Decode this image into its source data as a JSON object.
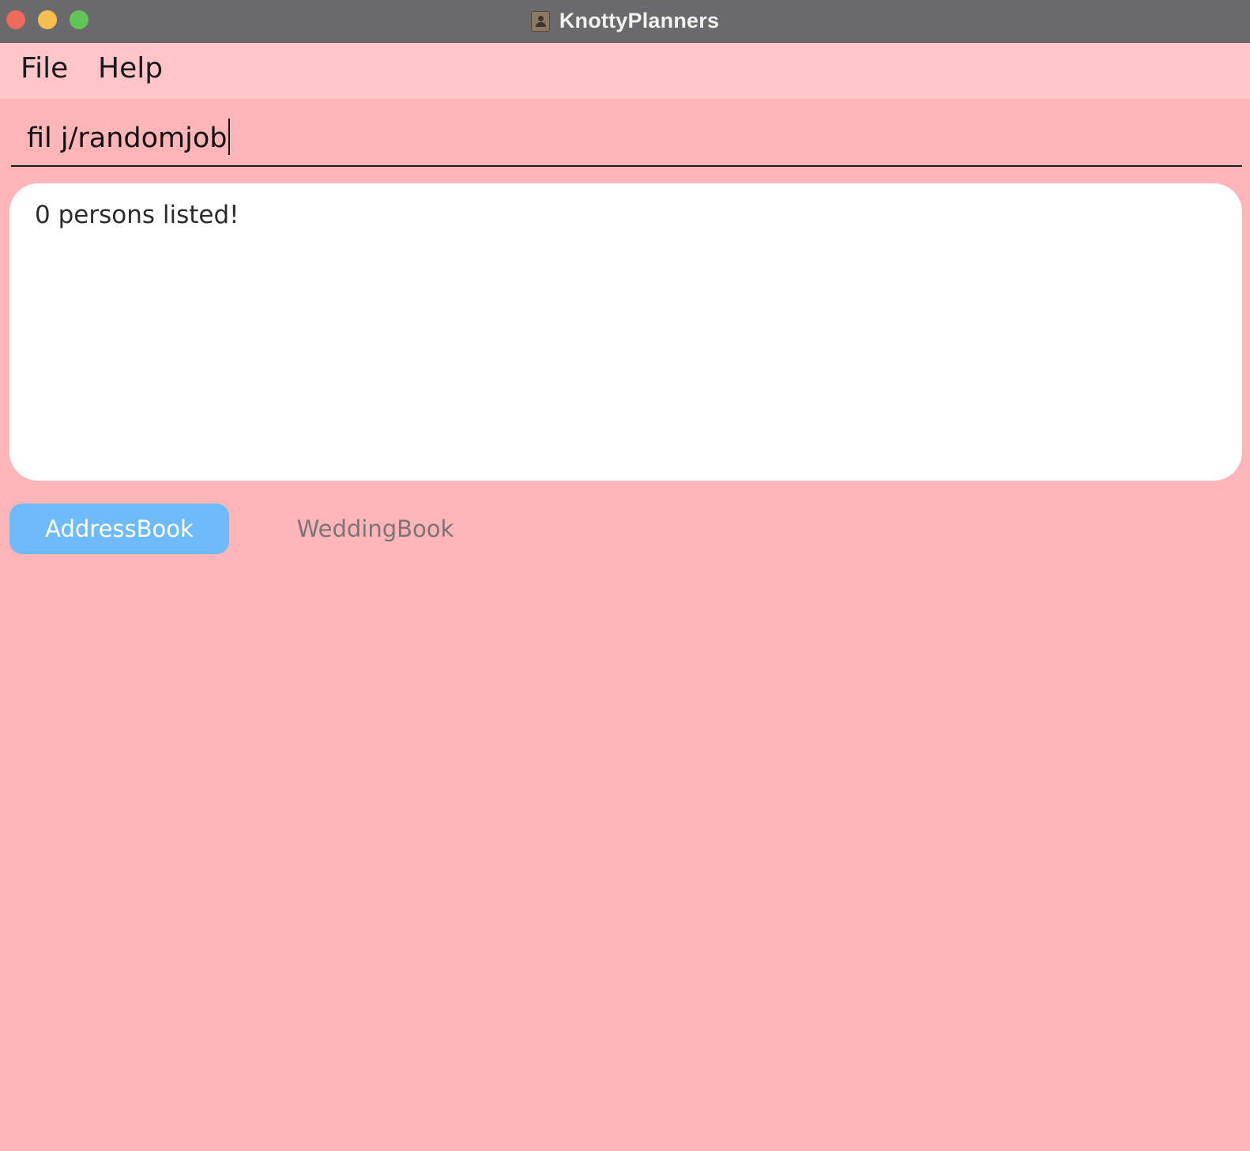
{
  "window": {
    "title": "KnottyPlanners",
    "app_icon": "contacts-app-icon",
    "buttons": [
      "close",
      "minimize",
      "maximize"
    ]
  },
  "menubar": {
    "items": [
      {
        "label": "File"
      },
      {
        "label": "Help"
      }
    ]
  },
  "command": {
    "value": "fil j/randomjob"
  },
  "result": {
    "text": "0 persons listed!"
  },
  "tabs": [
    {
      "label": "AddressBook",
      "selected": true
    },
    {
      "label": "WeddingBook",
      "selected": false
    }
  ],
  "colors": {
    "background": "#fdb5b8",
    "menubar": "#fec6c8",
    "titlebar": "#6a6a6c",
    "selected_tab": "#6ebbfc",
    "result_panel": "#ffffff"
  }
}
